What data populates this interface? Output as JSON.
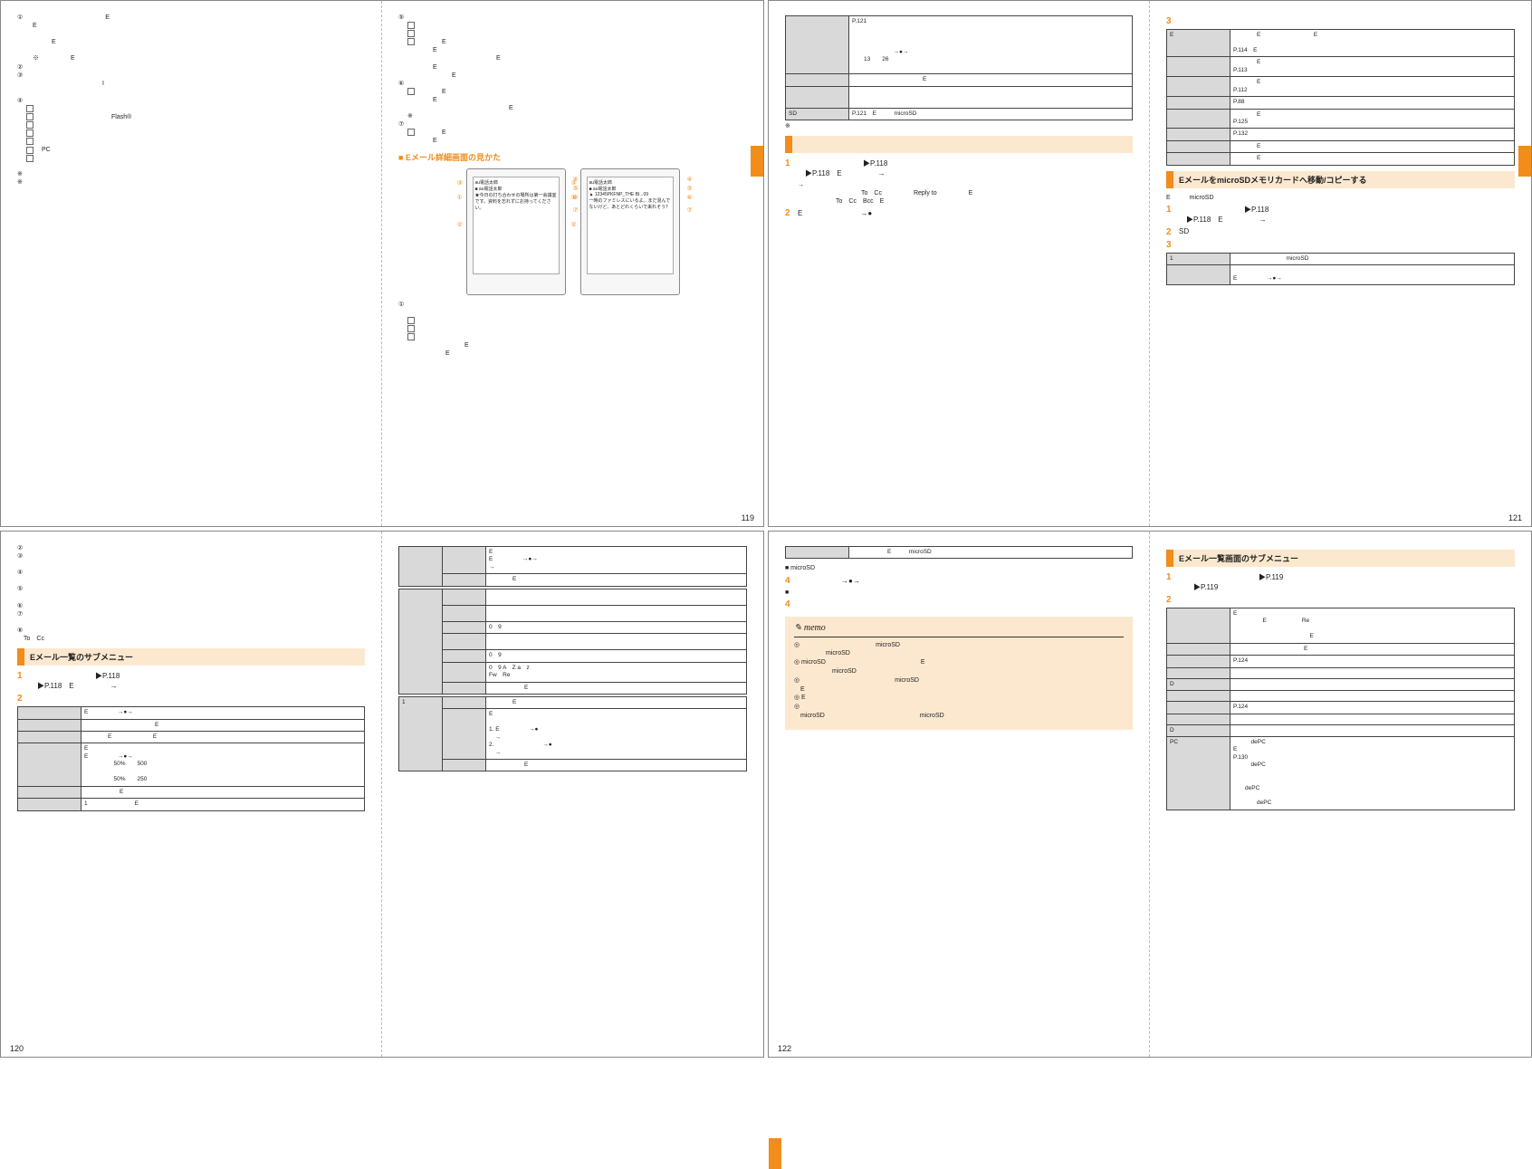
{
  "pgnum": {
    "p119": "119",
    "p120": "120",
    "p121": "121",
    "p122": "122"
  },
  "p119L": {
    "n1": "①　　　　　　　　　　　　　E",
    "n1t": "　E\n\n　　　　E\n\n　※　　　　　E",
    "n2": "②",
    "n3": "③",
    "n3t": "　　　　　　　　　　　　I",
    "n4": "④",
    "flash": "　　　　　　　　　　　　Flash®",
    "pc": "　PC",
    "note1": "※",
    "note2": "※"
  },
  "p119R": {
    "n5": "⑤",
    "n5t": "　　　　E\n　　　　E\n　　　　　　　　　　　　　　E\n　　　　E\n　　　　　　　E",
    "n6": "⑥",
    "n6t": "　　　　E\n　　　　E\n　　　　　　　　　　　　　　　　E\n※",
    "n7": "⑦",
    "n7t": "　　　　E\n　　　　E",
    "hE": "Eメール詳細画面の見かた",
    "phone1_scr": "au電話太郎\n■ au電話太郎\n★今日の打ち合わせの場所は第一会議室です。資料を忘れずにお持ってください。",
    "phone2_scr": "au電話太郎\n■ au電話太郎\n▲ 12345PKFNP_THE BI...09\n一時のファミレスにいるよ。まだ混んでないけど、あとどれくらいで来れそう？",
    "cb1": "①",
    "cb2": "②",
    "cb3": "③",
    "cb4": "④",
    "cb5": "⑤",
    "cb6": "⑥",
    "cb7": "⑦",
    "foot1": "①",
    "foot2": "　　　　　　　　　E\n　　　　　　E"
  },
  "p121L": {
    "tab": [
      [
        "",
        "P.121\n\n\n\n　　　　　　　→●→\n　　13　　26\n\n"
      ],
      [
        "",
        "　　　　　　　　　　　　E"
      ],
      [
        "",
        ""
      ],
      [
        "SD",
        "P.121　E　　　microSD"
      ]
    ],
    "star": "※",
    "hbox": "　　　　　　　　　　",
    "s1": "　　　　　　　　　▶P.118\n　▶P.118　E　　　　　→",
    "s1t": "→\n　　　　　　　　　　To　Cc　　　　　Reply to　　　　　E\n　　　　　　To　Cc　Bcc　E",
    "s2": "E　　　　　　　　→●"
  },
  "p121R": {
    "num3": "3",
    "tab": [
      [
        "E",
        "　　　　E　　　　　　　　　E\n\nP.114　E"
      ],
      [
        "",
        "　　　　E\nP.113"
      ],
      [
        "",
        "　　　　E\nP.112"
      ],
      [
        "",
        "P.88"
      ],
      [
        "",
        "　　　　E\nP.125"
      ],
      [
        "",
        "P.132"
      ],
      [
        "",
        "　　　　E"
      ],
      [
        "",
        "　　　　E"
      ]
    ],
    "h_sd": "EメールをmicroSDメモリカードへ移動/コピーする",
    "sdline": "E　　　microSD",
    "s1": "　　　　　　　　　▶P.118\n　▶P.118　E　　　　　→",
    "s2": "SD",
    "s3num": "3",
    "tab2": [
      [
        "1",
        "　　　　　　　　　microSD"
      ],
      [
        "",
        "　　　　\nE　　　　　→●→"
      ]
    ]
  },
  "p120L": {
    "top": "②\n③\n\n④\n\n⑤\n\n⑥\n⑦\n\n⑧\n　To　Cc",
    "hbox": "Eメール一覧のサブメニュー",
    "s1": "　　　　　　　　　▶P.118\n　▶P.118　E　　　　　→",
    "s2num": "2",
    "tab": [
      [
        "",
        "E　　　　　→●→\n"
      ],
      [
        "",
        "　　　　　　　　　　　　E"
      ],
      [
        "",
        "　　　　E　　　　　　　E"
      ],
      [
        "",
        "E\nE　　　　　→●→\n　　　　　50%　　500\n\n　　　　　50%　　250"
      ],
      [
        "",
        "　　　　　　E"
      ],
      [
        "",
        "1　　　　　　　　E"
      ]
    ]
  },
  "p120R": {
    "tab1": [
      [
        "",
        "",
        "E\nE　　　　　→●→\n→"
      ],
      [
        "",
        "",
        "　　　　E"
      ]
    ],
    "tab2": [
      [
        "",
        "",
        ""
      ],
      [
        "",
        "",
        ""
      ],
      [
        "",
        "",
        "0　9"
      ],
      [
        "",
        "",
        ""
      ],
      [
        "",
        "",
        "0　9"
      ],
      [
        "",
        "",
        "0　9 A　Z a　z\nFw　Re"
      ],
      [
        "",
        "",
        "　　　　　　E"
      ]
    ],
    "tab3": [
      [
        "1",
        "",
        "　　　　E"
      ],
      [
        "",
        "",
        "E\n\n1. E　　　　　→●\n　→\n2. 　　　　　　　　→●\n　→"
      ],
      [
        "",
        "",
        "　　　　　　E"
      ]
    ]
  },
  "p122L": {
    "tab0": [
      [
        "",
        "　　　　　　E　　　microSD"
      ]
    ],
    "sdline": "■ microSD",
    "s4a": "　　　　　　→●→",
    "blk": "■",
    "s4b": "4",
    "memo": {
      "title": "memo",
      "lines": [
        "◎　　　　　　　　　　　　microSD\n　　　　　microSD",
        "◎ microSD　　　　　　　　　　　　　　　E\n　　　　　　microSD",
        "◎　　　　　　　　　　　　　　　microSD\n　E",
        "◎ E\n",
        "◎\n　microSD　　　　　　　　　　　　　　　microSD"
      ]
    }
  },
  "p122R": {
    "hbox": "Eメール一覧画面のサブメニュー",
    "s1": "　　　　　　　　　　　▶P.119\n　　▶P.119",
    "s2num": "2",
    "tab": [
      [
        "",
        "E\n　　　　　E　　　　　　Re\n\n　　　　　　　　　　　　　E"
      ],
      [
        "",
        "　　　　　　　　　　　　E"
      ],
      [
        "",
        "P.124"
      ],
      [
        "",
        ""
      ],
      [
        "D",
        ""
      ],
      [
        "",
        ""
      ],
      [
        "",
        "P.124"
      ],
      [
        "",
        ""
      ],
      [
        "D",
        ""
      ],
      [
        "PC",
        "　　　dePC\nE\nP.130\n　　　dePC\n\n\n　　dePC\n\n　　　　dePC"
      ]
    ]
  }
}
